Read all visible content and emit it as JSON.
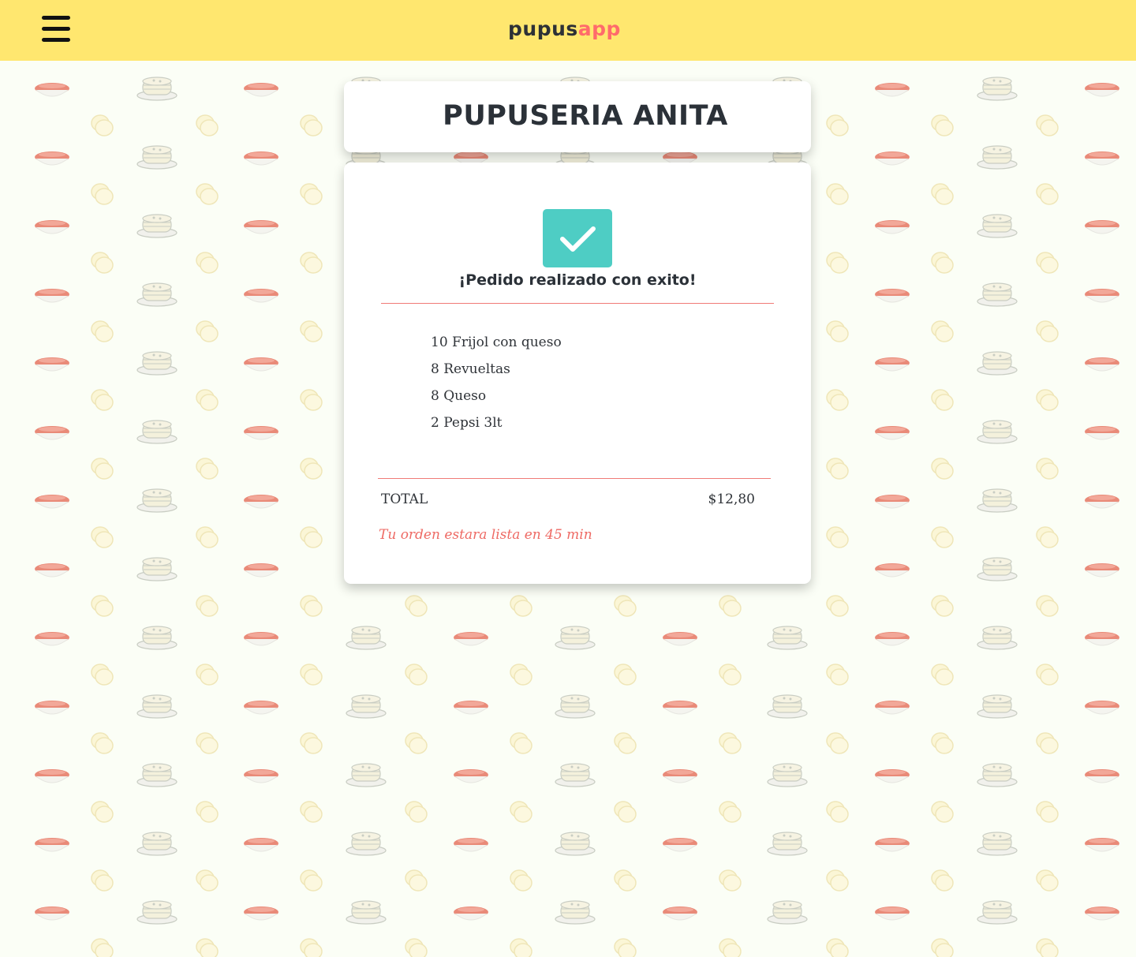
{
  "header": {
    "logo_part1": "pupus",
    "logo_part2": "app",
    "menu_icon": "hamburger-menu-icon",
    "background_color": "#ffe76f",
    "logo_accent_color": "#ff6b6b"
  },
  "restaurant": {
    "name": "PUPUSERIA ANITA"
  },
  "order": {
    "status_icon": "check-icon",
    "status_color": "#4ecdc4",
    "message": "¡Pedido realizado con exito!",
    "items": [
      "10 Frijol con queso",
      "8 Revueltas",
      "8 Queso",
      "2 Pepsi 3lt"
    ],
    "total_label": "TOTAL",
    "total_value": "$12,80",
    "eta": "Tu orden estara lista en 45 min"
  }
}
